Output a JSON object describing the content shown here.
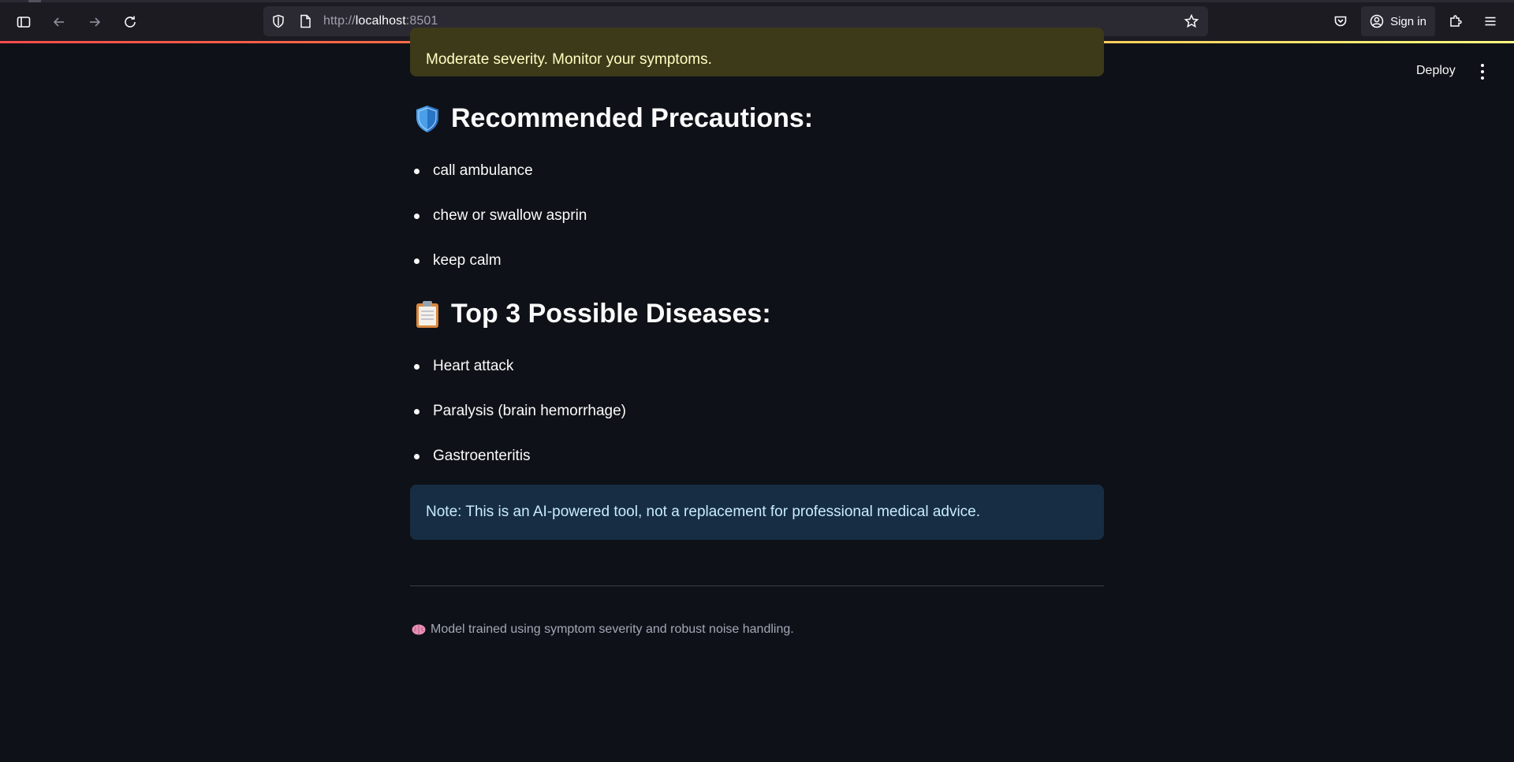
{
  "browser": {
    "url_host": "http://localhost",
    "url_port": ":8501",
    "signin_label": "Sign in"
  },
  "streamlit": {
    "deploy_label": "Deploy"
  },
  "severity_message": "Moderate severity. Monitor your symptoms.",
  "precautions": {
    "heading": "Recommended Precautions:",
    "icon": "shield-icon",
    "items": [
      "call ambulance",
      "chew or swallow asprin",
      "keep calm"
    ]
  },
  "diseases": {
    "heading": "Top 3 Possible Diseases:",
    "icon": "clipboard-icon",
    "items": [
      "Heart attack",
      "Paralysis (brain hemorrhage)",
      "Gastroenteritis"
    ]
  },
  "note": "Note: This is an AI-powered tool, not a replacement for professional medical advice.",
  "footer": {
    "icon": "brain-icon",
    "caption": "Model trained using symptom severity and robust noise handling."
  },
  "colors": {
    "background": "#0e1117",
    "warning_bg": "#3d3a1a",
    "warning_text": "#ffffc2",
    "info_bg": "#172d43",
    "info_text": "#c7ebff"
  }
}
